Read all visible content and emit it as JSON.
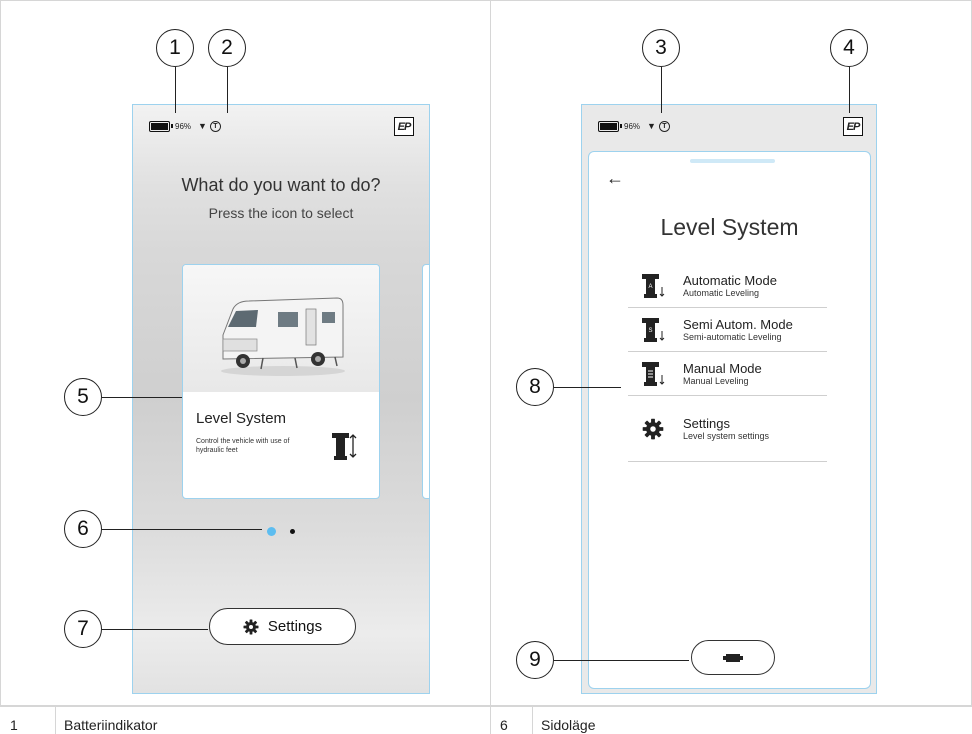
{
  "status_bar": {
    "battery_percent": "96%"
  },
  "logo": {
    "text": "EP"
  },
  "home": {
    "title": "What do you want to do?",
    "subtitle": "Press the icon to select",
    "card": {
      "title": "Level System",
      "description": "Control the vehicle with use of hydraulic feet"
    },
    "settings_label": "Settings"
  },
  "level_system": {
    "back_icon": "←",
    "title": "Level System",
    "items": [
      {
        "label": "Automatic Mode",
        "sub": "Automatic Leveling",
        "icon": "foot-a-icon",
        "letter": "A"
      },
      {
        "label": "Semi Autom. Mode",
        "sub": "Semi-automatic Leveling",
        "icon": "foot-s-icon",
        "letter": "S"
      },
      {
        "label": "Manual Mode",
        "sub": "Manual Leveling",
        "icon": "foot-manual-icon",
        "letter": ""
      },
      {
        "label": "Settings",
        "sub": "Level system settings",
        "icon": "gear-icon",
        "letter": ""
      }
    ]
  },
  "callouts": [
    "1",
    "2",
    "3",
    "4",
    "5",
    "6",
    "7",
    "8",
    "9"
  ],
  "legend": [
    {
      "num": "1",
      "text": "Batteriindikator"
    },
    {
      "num": "6",
      "text": "Sidoläge"
    }
  ],
  "colors": {
    "accent": "#5dbdf0",
    "frame": "#9dd2ee"
  }
}
